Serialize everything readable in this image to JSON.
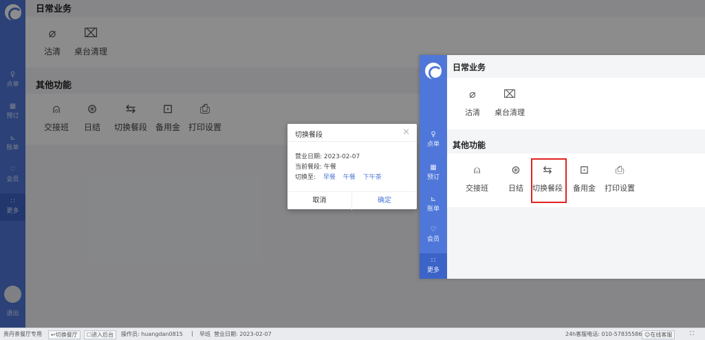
{
  "background": {
    "nav": [
      {
        "icon": "order-icon",
        "label": "点单"
      },
      {
        "icon": "reserve-icon",
        "label": "预订"
      },
      {
        "icon": "bill-icon",
        "label": "账单"
      },
      {
        "icon": "member-icon",
        "label": "会员"
      },
      {
        "icon": "more-icon",
        "label": "更多"
      }
    ],
    "logout_label": "退出",
    "sections": {
      "daily_title": "日常业务",
      "daily_items": [
        {
          "icon": "clean-icon",
          "label": "沽清"
        },
        {
          "icon": "table-clean-icon",
          "label": "桌台清理"
        }
      ],
      "other_title": "其他功能",
      "other_items": [
        {
          "icon": "shift-icon",
          "label": "交接班"
        },
        {
          "icon": "daily-settle-icon",
          "label": "日结"
        },
        {
          "icon": "switch-meal-icon",
          "label": "切换餐段"
        },
        {
          "icon": "reserve-fund-icon",
          "label": "备用金"
        },
        {
          "icon": "print-icon",
          "label": "打印设置"
        }
      ]
    }
  },
  "dialog": {
    "title": "切换餐段",
    "business_date": "营业日期: 2023-02-07",
    "current_meal": "当前餐段: 午餐",
    "switch_to_label": "切换至:",
    "options": [
      "早餐",
      "午餐",
      "下午茶"
    ],
    "cancel_label": "取消",
    "ok_label": "确定"
  },
  "statusbar": {
    "store": "贵丹茶餐厅专用",
    "switch_store": "↩切换餐厅",
    "backend": "☐进入后台",
    "operator": "操作员: huangdan0815",
    "separator": "|",
    "shift": "早班",
    "date": "营业日期: 2023-02-07",
    "hotline": "24h客服电话: 010-57835586",
    "online_service": "☺在线客服",
    "expand": "⛶"
  },
  "zoom": {
    "highlight_color": "#e02020"
  },
  "colors": {
    "accent": "#4f77d9",
    "highlight": "#e02020"
  }
}
